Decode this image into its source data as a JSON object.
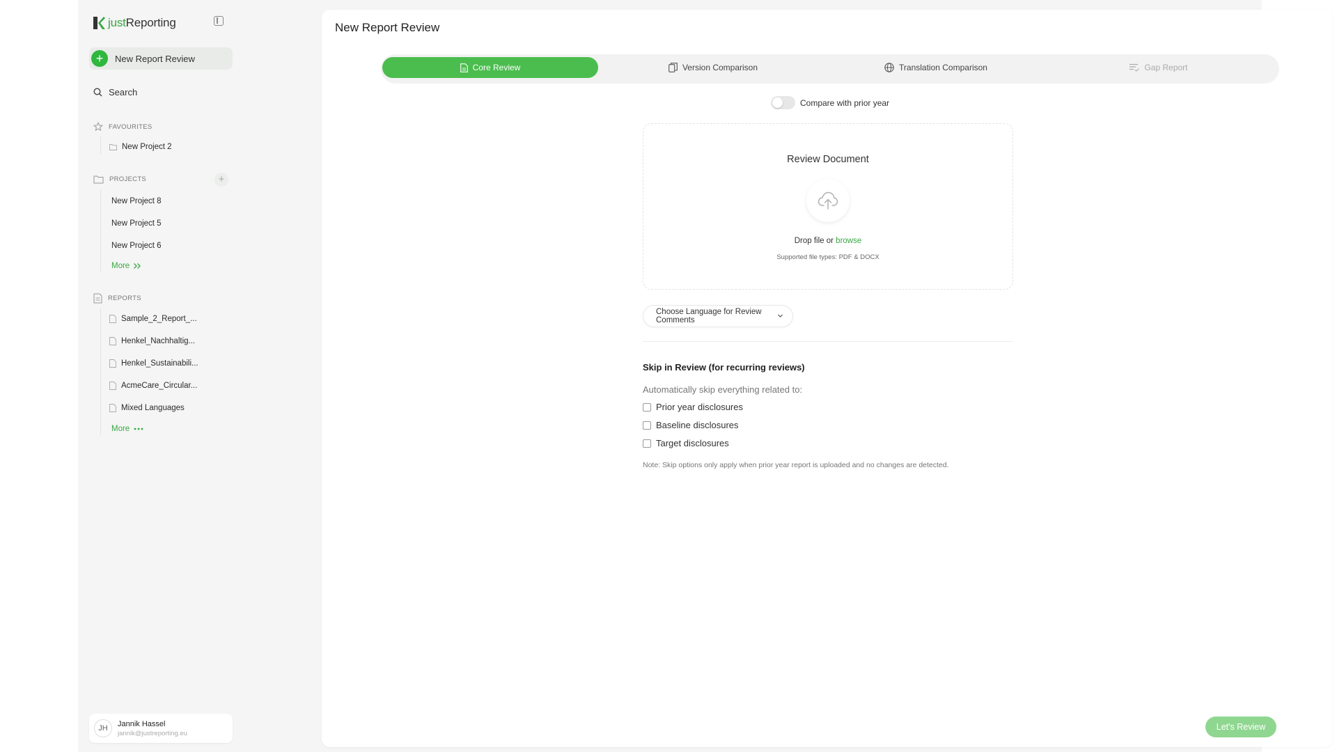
{
  "app": {
    "logo_prefix": "just",
    "logo_suffix": "Reporting"
  },
  "sidebar": {
    "new_review_label": "New Report Review",
    "search_label": "Search",
    "favourites": {
      "title": "FAVOURITES",
      "items": [
        "New Project 2"
      ]
    },
    "projects": {
      "title": "PROJECTS",
      "items": [
        "New Project 8",
        "New Project 5",
        "New Project 6"
      ],
      "more_label": "More"
    },
    "reports": {
      "title": "REPORTS",
      "items": [
        "Sample_2_Report_...",
        "Henkel_Nachhaltig...",
        "Henkel_Sustainabili...",
        "AcmeCare_Circular...",
        "Mixed Languages"
      ],
      "more_label": "More"
    },
    "user": {
      "initials": "JH",
      "name": "Jannik Hassel",
      "email": "jannik@justreporting.eu"
    }
  },
  "main": {
    "title": "New Report Review",
    "tabs": [
      {
        "label": "Core Review",
        "icon": "document-icon",
        "state": "active"
      },
      {
        "label": "Version Comparison",
        "icon": "copy-icon",
        "state": "normal"
      },
      {
        "label": "Translation Comparison",
        "icon": "globe-icon",
        "state": "normal"
      },
      {
        "label": "Gap Report",
        "icon": "lines-icon",
        "state": "disabled"
      }
    ],
    "compare_toggle_label": "Compare with prior year",
    "compare_toggle_on": false,
    "dropzone": {
      "title": "Review Document",
      "icon": "cloud-upload-icon",
      "drop_text": "Drop file or ",
      "browse_label": "browse",
      "supported_types": "Supported file types: PDF & DOCX"
    },
    "language_select": {
      "label": "Choose Language for Review Comments"
    },
    "skip": {
      "title": "Skip in Review (for recurring reviews)",
      "subtitle": "Automatically skip everything related to:",
      "options": [
        {
          "label": "Prior year disclosures",
          "checked": false
        },
        {
          "label": "Baseline disclosures",
          "checked": false
        },
        {
          "label": "Target disclosures",
          "checked": false
        }
      ],
      "note": "Note: Skip options only apply when prior year report is uploaded and no changes are detected."
    },
    "submit_label": "Let's Review"
  },
  "colors": {
    "brand_green": "#3aa644",
    "active_tab": "#4bbd4e",
    "disabled_button": "#8fd790",
    "sidebar_bg": "#f4f5f4"
  }
}
